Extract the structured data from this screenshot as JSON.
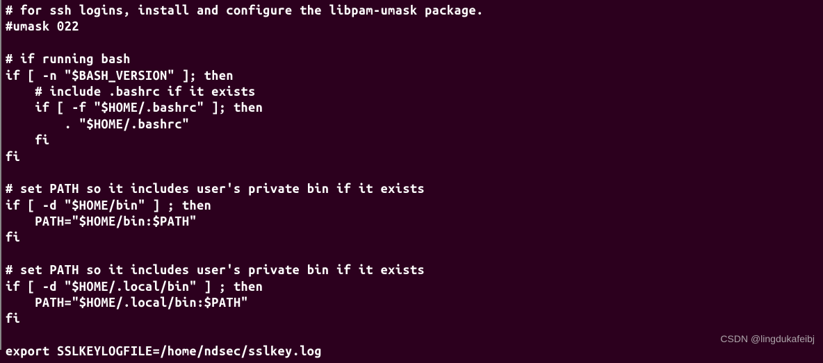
{
  "terminal": {
    "lines": [
      "# for ssh logins, install and configure the libpam-umask package.",
      "#umask 022",
      "",
      "# if running bash",
      "if [ -n \"$BASH_VERSION\" ]; then",
      "    # include .bashrc if it exists",
      "    if [ -f \"$HOME/.bashrc\" ]; then",
      "        . \"$HOME/.bashrc\"",
      "    fi",
      "fi",
      "",
      "# set PATH so it includes user's private bin if it exists",
      "if [ -d \"$HOME/bin\" ] ; then",
      "    PATH=\"$HOME/bin:$PATH\"",
      "fi",
      "",
      "# set PATH so it includes user's private bin if it exists",
      "if [ -d \"$HOME/.local/bin\" ] ; then",
      "    PATH=\"$HOME/.local/bin:$PATH\"",
      "fi",
      "",
      "export SSLKEYLOGFILE=/home/ndsec/sslkey.log"
    ]
  },
  "watermark": {
    "text": "CSDN @lingdukafeibj"
  }
}
